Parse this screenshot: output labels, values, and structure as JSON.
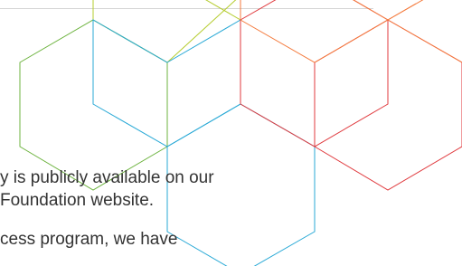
{
  "body_text": {
    "line_1": "y is publicly available on our",
    "line_2": "Foundation website.",
    "line_3": "cess program, we have"
  },
  "decoration": {
    "hexagon_colors": {
      "green": "#6db33f",
      "yellow_green": "#b5cc2e",
      "blue": "#29a9d6",
      "red": "#e03a3e",
      "orange": "#f47a3c"
    }
  }
}
